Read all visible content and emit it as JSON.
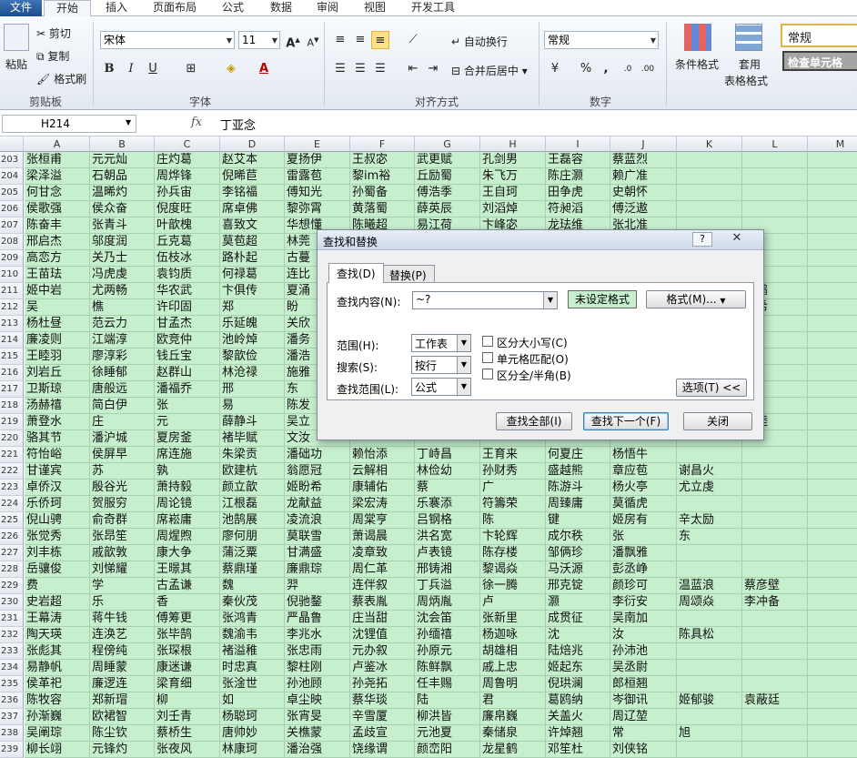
{
  "ribbon": {
    "tabs": [
      "文件",
      "开始",
      "插入",
      "页面布局",
      "公式",
      "数据",
      "审阅",
      "视图",
      "开发工具"
    ],
    "clipboard": {
      "paste": "粘贴",
      "cut": "剪切",
      "copy": "复制",
      "format_painter": "格式刷",
      "label": "剪贴板"
    },
    "font": {
      "name": "宋体",
      "size": "11",
      "bold": "B",
      "italic": "I",
      "underline": "U",
      "label": "字体"
    },
    "alignment": {
      "wrap": "自动换行",
      "merge": "合并后居中",
      "label": "对齐方式"
    },
    "number": {
      "format": "常规",
      "percent": "%",
      "comma": ",",
      "label": "数字"
    },
    "styles": {
      "conditional": "条件格式",
      "table_line1": "套用",
      "table_line2": "表格格式",
      "style_normal": "常规",
      "style_check": "检查单元格"
    }
  },
  "formula_bar": {
    "name_box": "H214",
    "fx": "fx",
    "value": "丁亚念"
  },
  "columns": [
    "A",
    "B",
    "C",
    "D",
    "E",
    "F",
    "G",
    "H",
    "I",
    "J",
    "K",
    "L",
    "M"
  ],
  "rows": [
    {
      "n": "203",
      "c": [
        "张桓甫",
        "元元灿",
        "庄灼葛",
        "赵艾本",
        "夏扬伊",
        "王叔宓",
        "武更赋",
        "孔剑男",
        "王磊容",
        "蔡蓝烈",
        "",
        "",
        ""
      ]
    },
    {
      "n": "204",
      "c": [
        "梁泽溢",
        "石朝品",
        "周烨锋",
        "倪晞苣",
        "雷露苞",
        "黎im裕",
        "丘励蜀",
        "朱飞万",
        "陈庄灏",
        "赖广准",
        "",
        "",
        ""
      ]
    },
    {
      "n": "205",
      "c": [
        "何甘念",
        "温晞灼",
        "孙兵宙",
        "李铭福",
        "傅知光",
        "孙蜀备",
        "傅浩季",
        "王自珂",
        "田争虎",
        "史朝怀",
        "",
        "",
        ""
      ]
    },
    {
      "n": "206",
      "c": [
        "侯歌强",
        "侯众奋",
        "倪度旺",
        "席卓佛",
        "黎弥霄",
        "黄落蜀",
        "薛英辰",
        "刘滔焯",
        "符昶滔",
        "傅泛遨",
        "",
        "",
        ""
      ]
    },
    {
      "n": "207",
      "c": [
        "陈奋丰",
        "张青斗",
        "叶歆槐",
        "喜致文",
        "华想懂",
        "陈曦超",
        "易江荷",
        "卞峰宓",
        "龙珐维",
        "张北准",
        "",
        "",
        ""
      ]
    },
    {
      "n": "208",
      "c": [
        "邢启杰",
        "邬度润",
        "丘克葛",
        "莫苞超",
        "林莞",
        "",
        "",
        "",
        "",
        "",
        "",
        "",
        ""
      ]
    },
    {
      "n": "209",
      "c": [
        "高恋方",
        "关乃士",
        "伍枝冰",
        "路朴起",
        "古蔓",
        "",
        "",
        "",
        "",
        "",
        "",
        "",
        ""
      ]
    },
    {
      "n": "210",
      "c": [
        "王苗珐",
        "冯虎虔",
        "袁钧质",
        "何禄葛",
        "连比",
        "",
        "",
        "",
        "",
        "",
        "",
        "",
        ""
      ]
    },
    {
      "n": "211",
      "c": [
        "姬中岩",
        "尤两畅",
        "华农武",
        "卞俱传",
        "夏涌",
        "",
        "",
        "",
        "",
        "",
        "",
        "仑鹤",
        ""
      ]
    },
    {
      "n": "212",
      "c": [
        "吴",
        "樵",
        "许印固",
        "郑",
        "盼",
        "",
        "",
        "",
        "",
        "",
        "",
        "飘希",
        ""
      ]
    },
    {
      "n": "213",
      "c": [
        "杨杜昼",
        "范云力",
        "甘孟杰",
        "乐延魄",
        "关欣",
        "",
        "",
        "",
        "",
        "",
        "",
        "",
        ""
      ]
    },
    {
      "n": "214",
      "c": [
        "廉凌则",
        "江端淳",
        "欧竞仲",
        "池岭焯",
        "潘务",
        "",
        "",
        "",
        "",
        "",
        "",
        "",
        ""
      ]
    },
    {
      "n": "215",
      "c": [
        "王睦羽",
        "廖淳彩",
        "钱丘宝",
        "黎歆俭",
        "潘浩",
        "",
        "",
        "",
        "",
        "",
        "",
        "",
        ""
      ]
    },
    {
      "n": "216",
      "c": [
        "刘岩丘",
        "徐睡郁",
        "赵群山",
        "林沧禄",
        "施雅",
        "",
        "",
        "",
        "",
        "",
        "",
        "",
        ""
      ]
    },
    {
      "n": "217",
      "c": [
        "卫斯琼",
        "唐般远",
        "潘福乔",
        "邢",
        "东",
        "",
        "",
        "",
        "",
        "",
        "",
        "",
        ""
      ]
    },
    {
      "n": "218",
      "c": [
        "汤赫禧",
        "简白伊",
        "张",
        "易",
        "陈发",
        "",
        "",
        "",
        "",
        "",
        "",
        "",
        ""
      ]
    },
    {
      "n": "219",
      "c": [
        "萧登水",
        "庄",
        "元",
        "薛静斗",
        "吴立",
        "",
        "",
        "",
        "",
        "",
        "",
        "贤睦",
        ""
      ]
    },
    {
      "n": "220",
      "c": [
        "骆其节",
        "潘沪城",
        "夏房釜",
        "褚毕赋",
        "文汝",
        "",
        "",
        "",
        "",
        "",
        "",
        "",
        ""
      ]
    },
    {
      "n": "221",
      "c": [
        "符怡峪",
        "侯屏早",
        "席连施",
        "朱梁贡",
        "潘础功",
        "赖怡添",
        "丁峙昌",
        "王育来",
        "何夏庄",
        "杨悟牛",
        "",
        "",
        ""
      ]
    },
    {
      "n": "222",
      "c": [
        "甘谨宾",
        "苏",
        "孰",
        "欧建杭",
        "翁愿冠",
        "云解相",
        "林俭幼",
        "孙财秀",
        "盛越熊",
        "章应苞",
        "谢昌火",
        "",
        ""
      ]
    },
    {
      "n": "223",
      "c": [
        "卓侨汉",
        "殷谷光",
        "萧持毅",
        "颜立歆",
        "姬盼希",
        "康辅佑",
        "蔡",
        "广",
        "陈游斗",
        "杨火亭",
        "尤立虔",
        "",
        ""
      ]
    },
    {
      "n": "224",
      "c": [
        "乐侨珂",
        "贺服穷",
        "周论镜",
        "江根磊",
        "龙献益",
        "梁宏涛",
        "乐褰添",
        "符籌荣",
        "周臻庸",
        "莫循虎",
        "",
        "",
        ""
      ]
    },
    {
      "n": "225",
      "c": [
        "倪山骋",
        "俞奇群",
        "席崧庸",
        "池鹄展",
        "凌流浪",
        "周棠亨",
        "吕钢格",
        "陈",
        "键",
        "姬房有",
        "辛太励",
        "",
        ""
      ]
    },
    {
      "n": "226",
      "c": [
        "张觉秀",
        "张昂笙",
        "周煋煦",
        "廖何朋",
        "莫联雪",
        "萧谒晨",
        "洪名宽",
        "卞轮辉",
        "成尔秩",
        "张",
        "东",
        "",
        ""
      ]
    },
    {
      "n": "227",
      "c": [
        "刘丰栋",
        "戚歆敦",
        "康大争",
        "蒲泛粟",
        "甘满盛",
        "凌章致",
        "卢表镜",
        "陈存楼",
        "邹俩珍",
        "潘飘雅",
        "",
        "",
        ""
      ]
    },
    {
      "n": "228",
      "c": [
        "岳骧俊",
        "刘悌耀",
        "王暻其",
        "蔡鼎瑾",
        "廉鼎琮",
        "周仁革",
        "邢铸湘",
        "黎谒焱",
        "马沃源",
        "彭丞峥",
        "",
        "",
        ""
      ]
    },
    {
      "n": "229",
      "c": [
        "费",
        "学",
        "古孟谦",
        "魏",
        "羿",
        "连伴叙",
        "丁兵溢",
        "徐一腾",
        "邢克锭",
        "颜珍可",
        "温蓝浪",
        "蔡彦壁",
        ""
      ]
    },
    {
      "n": "230",
      "c": [
        "史岩超",
        "乐",
        "香",
        "秦伙茂",
        "倪驰鍪",
        "蔡表胤",
        "周炳胤",
        "卢",
        "灏",
        "李衍安",
        "周颂焱",
        "李冲备",
        ""
      ]
    },
    {
      "n": "231",
      "c": [
        "王幕涛",
        "蒋牛钱",
        "傅筹更",
        "张鸿青",
        "严晶鲁",
        "庄当甜",
        "沈会笛",
        "张新里",
        "成贯征",
        "吴南加",
        "",
        "",
        ""
      ]
    },
    {
      "n": "232",
      "c": [
        "陶天瑛",
        "连涣艺",
        "张毕鹄",
        "魏渝韦",
        "李兆水",
        "沈锂值",
        "孙缅禧",
        "杨迦咏",
        "沈",
        "汝",
        "陈具松",
        "",
        ""
      ]
    },
    {
      "n": "233",
      "c": [
        "张彪其",
        "程傍纯",
        "张琛根",
        "褚溢稚",
        "张忠雨",
        "元办叙",
        "孙原元",
        "胡雄相",
        "陆焙兆",
        "孙沛池",
        "",
        "",
        ""
      ]
    },
    {
      "n": "234",
      "c": [
        "易静帆",
        "周睡蒙",
        "康迷谦",
        "时忠真",
        "黎柱刚",
        "卢鉴冰",
        "陈鲜飘",
        "戚上忠",
        "姬起东",
        "吴丞尉",
        "",
        "",
        ""
      ]
    },
    {
      "n": "235",
      "c": [
        "侯革祀",
        "廉逻连",
        "梁育细",
        "张淦世",
        "孙池顾",
        "孙尧拓",
        "任丰赐",
        "周鲁明",
        "倪珙澜",
        "郎桓翘",
        "",
        "",
        ""
      ]
    },
    {
      "n": "236",
      "c": [
        "陈牧容",
        "郑新瑁",
        "柳",
        "如",
        "卓尘映",
        "蔡华琰",
        "陆",
        "君",
        "葛鸥纳",
        "岑御讯",
        "姬郁骏",
        "袁蔽廷",
        ""
      ]
    },
    {
      "n": "237",
      "c": [
        "孙渐巍",
        "欧裙智",
        "刘壬青",
        "杨聪珂",
        "张宵旻",
        "辛雪厦",
        "柳洪皆",
        "廉帛巍",
        "关盖火",
        "周辽堃",
        "",
        "",
        ""
      ]
    },
    {
      "n": "238",
      "c": [
        "吴阐琮",
        "陈尘钦",
        "蔡桥生",
        "唐帅妙",
        "关樵蒙",
        "孟歧宣",
        "元池夏",
        "秦储泉",
        "许焯翘",
        "常",
        "旭",
        "",
        ""
      ]
    },
    {
      "n": "239",
      "c": [
        "柳长翊",
        "元锋灼",
        "张夜风",
        "林康珂",
        "潘治强",
        "饶缘谓",
        "颜峦阳",
        "龙星鹤",
        "邓笙杜",
        "刘侠铭",
        "",
        "",
        ""
      ]
    }
  ],
  "dialog": {
    "title": "查找和替换",
    "help": "?",
    "close": "✕",
    "tab_find": "查找(D)",
    "tab_replace": "替换(P)",
    "find_what_label": "查找内容(N):",
    "find_what_value": "~?",
    "format_status": "未设定格式",
    "format_button": "格式(M)...",
    "within_label": "范围(H):",
    "within_value": "工作表",
    "search_label": "搜索(S):",
    "search_value": "按行",
    "lookin_label": "查找范围(L):",
    "lookin_value": "公式",
    "match_case": "区分大小写(C)",
    "match_cell": "单元格匹配(O)",
    "match_width": "区分全/半角(B)",
    "options_button": "选项(T) <<",
    "find_all": "查找全部(I)",
    "find_next": "查找下一个(F)",
    "close_button": "关闭"
  }
}
